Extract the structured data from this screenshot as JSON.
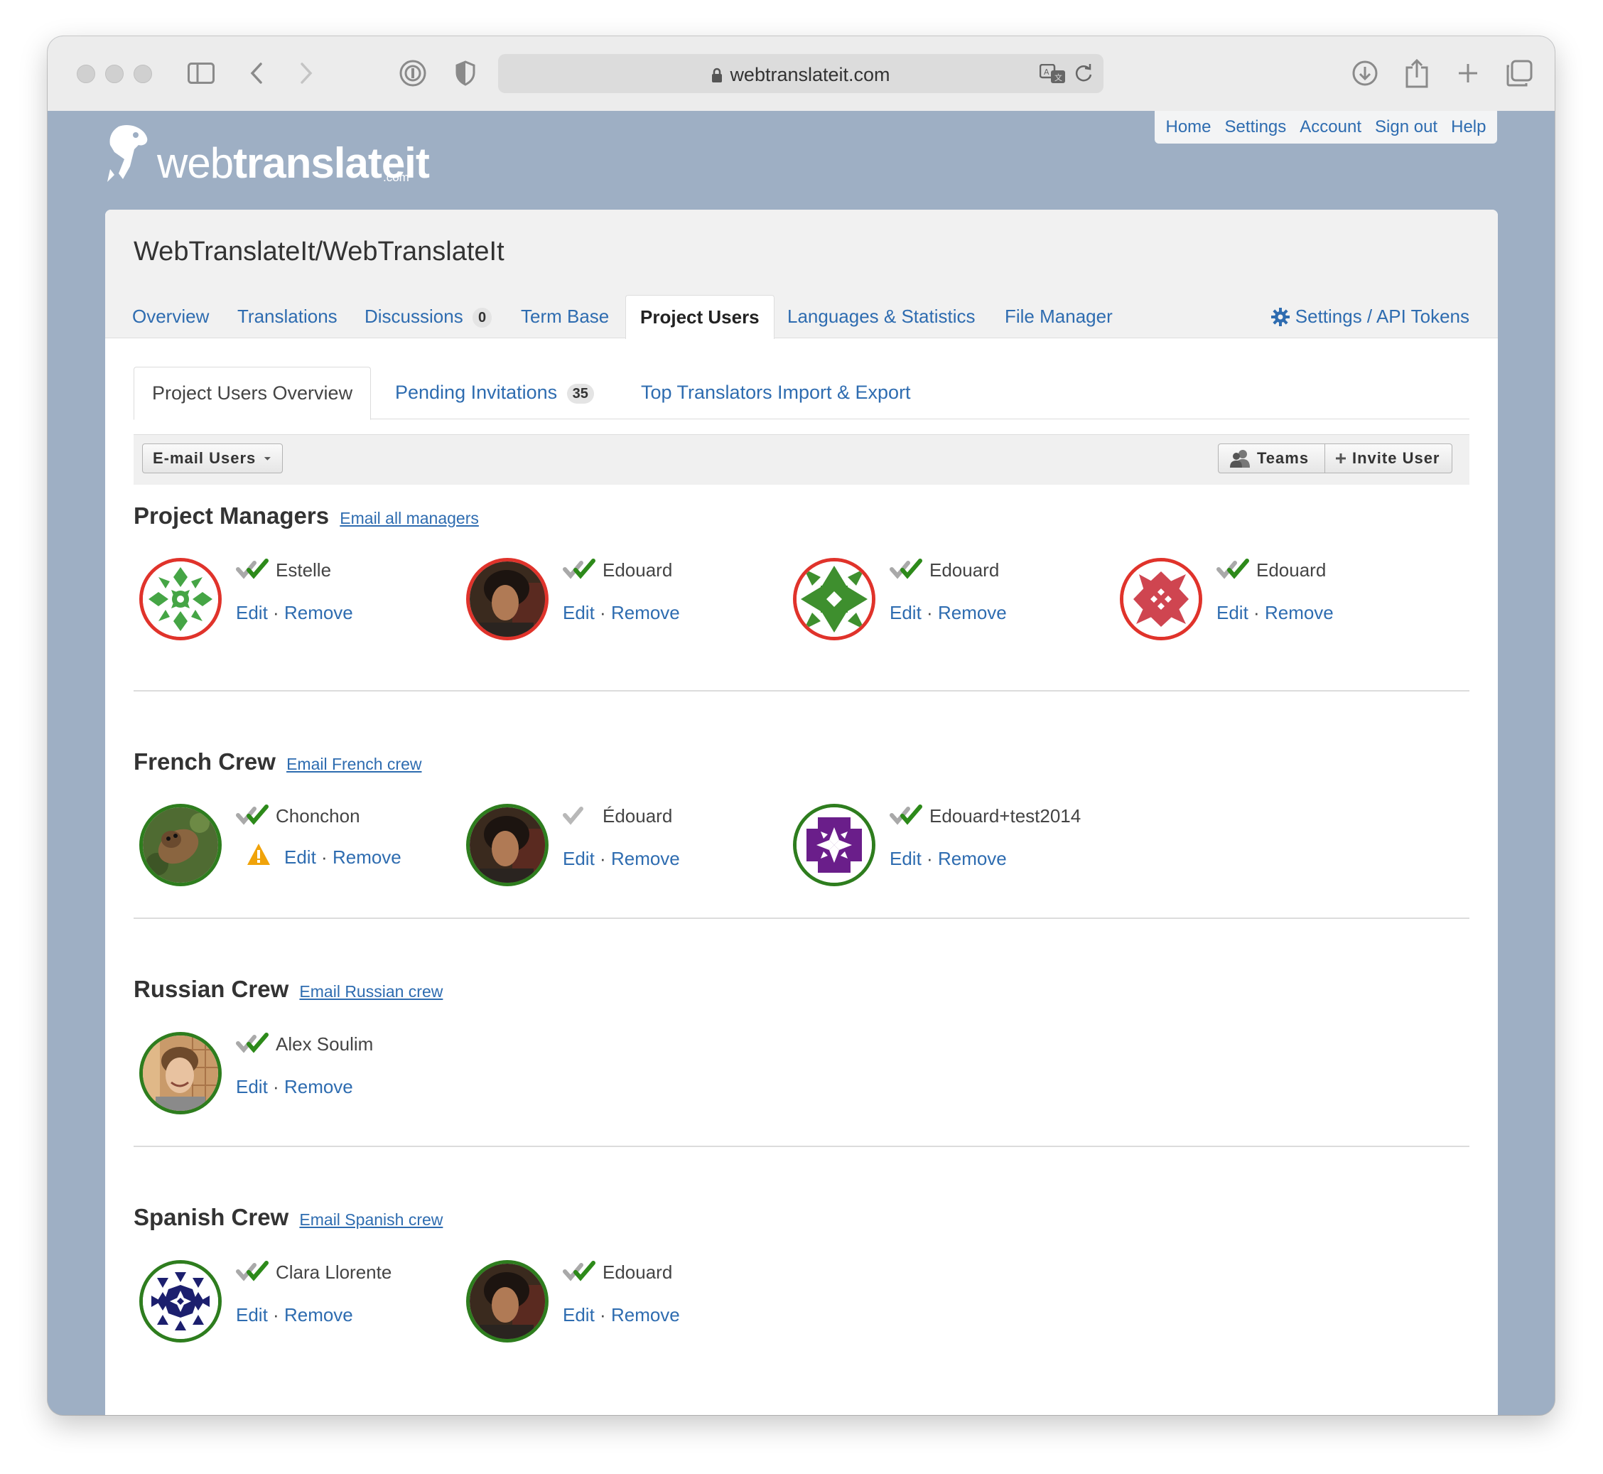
{
  "browser": {
    "url": "webtranslateit.com"
  },
  "logo": {
    "text_light": "web",
    "text_bold": "translateit",
    "suffix": ".com"
  },
  "top_nav": [
    "Home",
    "Settings",
    "Account",
    "Sign out",
    "Help"
  ],
  "project": {
    "title": "WebTranslateIt/WebTranslateIt"
  },
  "tabs": [
    {
      "label": "Overview"
    },
    {
      "label": "Translations"
    },
    {
      "label": "Discussions",
      "count": "0"
    },
    {
      "label": "Term Base"
    },
    {
      "label": "Project Users",
      "active": true
    },
    {
      "label": "Languages & Statistics"
    },
    {
      "label": "File Manager"
    }
  ],
  "settings_tab": "Settings / API Tokens",
  "subtabs": [
    {
      "label": "Project Users Overview",
      "active": true
    },
    {
      "label": "Pending Invitations",
      "count": "35"
    },
    {
      "label": "Top Translators"
    },
    {
      "label": "Import & Export"
    }
  ],
  "actions": {
    "email_users": "E-mail Users",
    "teams": "Teams",
    "invite_user": "Invite User"
  },
  "link_labels": {
    "edit": "Edit",
    "separator": "·",
    "remove": "Remove"
  },
  "sections": [
    {
      "title": "Project Managers",
      "email_link": "Email all managers",
      "users": [
        {
          "name": "Estelle",
          "status": "verified"
        },
        {
          "name": "Edouard",
          "status": "verified"
        },
        {
          "name": "Edouard",
          "status": "verified"
        },
        {
          "name": "Edouard",
          "status": "verified"
        }
      ]
    },
    {
      "title": "French Crew",
      "email_link": "Email French crew",
      "users": [
        {
          "name": "Chonchon",
          "status": "verified",
          "warning": true
        },
        {
          "name": "Édouard",
          "status": "unverified"
        },
        {
          "name": "Edouard+test2014",
          "status": "verified"
        }
      ]
    },
    {
      "title": "Russian Crew",
      "email_link": "Email Russian crew",
      "users": [
        {
          "name": "Alex Soulim",
          "status": "verified"
        }
      ]
    },
    {
      "title": "Spanish Crew",
      "email_link": "Email Spanish crew",
      "users": [
        {
          "name": "Clara Llorente",
          "status": "verified"
        },
        {
          "name": "Edouard",
          "status": "verified"
        }
      ]
    }
  ],
  "colors": {
    "link": "#2e6cb0",
    "manager_ring": "#e0332b",
    "crew_ring": "#2e7d1e",
    "page_bg": "#9eafc4",
    "warning": "#f0a30a"
  }
}
